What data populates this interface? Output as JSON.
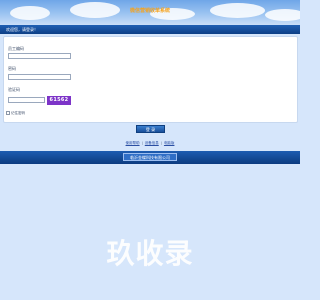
{
  "app": {
    "title": "微信营销收单系统"
  },
  "welcome": {
    "text": "欢迎您，请登录！"
  },
  "form": {
    "employee_label": "员工编码",
    "password_label": "密码",
    "captcha_label": "验证码",
    "employee_value": "",
    "password_value": "",
    "captcha_value": "",
    "captcha_code": "61562",
    "remember_label": "记住密码"
  },
  "actions": {
    "login_label": "登 录"
  },
  "links": [
    {
      "label": "使用帮助"
    },
    {
      "label": "设备信息"
    },
    {
      "label": "电脑版"
    }
  ],
  "footer": {
    "button_label": "临沂金蝶科技有限公司"
  },
  "watermark": {
    "text": "玖收录"
  },
  "colors": {
    "primary_bar": "#0d3f86",
    "background": "#d6e6fb",
    "captcha_bg": "#7d34c8",
    "title_color": "#f6a31d"
  }
}
